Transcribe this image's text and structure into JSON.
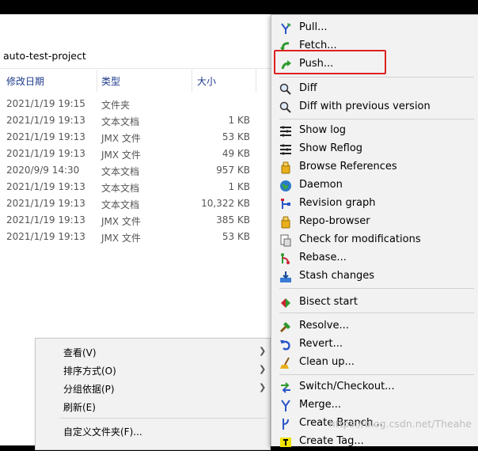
{
  "explorer": {
    "path": "auto-test-project",
    "columns": {
      "date": "修改日期",
      "type": "类型",
      "size": "大小"
    },
    "rows": [
      {
        "date": "2021/1/19 19:15",
        "type": "文件夹",
        "size": ""
      },
      {
        "date": "2021/1/19 19:13",
        "type": "文本文档",
        "size": "1 KB"
      },
      {
        "date": "2021/1/19 19:13",
        "type": "JMX 文件",
        "size": "53 KB"
      },
      {
        "date": "2021/1/19 19:13",
        "type": "JMX 文件",
        "size": "49 KB"
      },
      {
        "date": "2020/9/9 14:30",
        "type": "文本文档",
        "size": "957 KB"
      },
      {
        "date": "2021/1/19 19:13",
        "type": "文本文档",
        "size": "1 KB"
      },
      {
        "date": "2021/1/19 19:13",
        "type": "文本文档",
        "size": "10,322 KB"
      },
      {
        "date": "2021/1/19 19:13",
        "type": "JMX 文件",
        "size": "385 KB"
      },
      {
        "date": "2021/1/19 19:13",
        "type": "JMX 文件",
        "size": "53 KB"
      }
    ]
  },
  "context_menu": {
    "items": [
      {
        "label": "查看(V)",
        "has_submenu": true
      },
      {
        "label": "排序方式(O)",
        "has_submenu": true
      },
      {
        "label": "分组依据(P)",
        "has_submenu": true
      },
      {
        "label": "刷新(E)",
        "has_submenu": false
      },
      {
        "label": "自定义文件夹(F)...",
        "has_submenu": false
      }
    ]
  },
  "git_menu": {
    "items": [
      {
        "label": "Pull...",
        "icon": "pull-icon"
      },
      {
        "label": "Fetch...",
        "icon": "fetch-icon"
      },
      {
        "label": "Push...",
        "icon": "push-icon"
      },
      {
        "label": "Diff",
        "icon": "diff-icon"
      },
      {
        "label": "Diff with previous version",
        "icon": "diff-previous-icon"
      },
      {
        "label": "Show log",
        "icon": "show-log-icon"
      },
      {
        "label": "Show Reflog",
        "icon": "show-reflog-icon"
      },
      {
        "label": "Browse References",
        "icon": "browse-references-icon"
      },
      {
        "label": "Daemon",
        "icon": "daemon-icon"
      },
      {
        "label": "Revision graph",
        "icon": "revision-graph-icon"
      },
      {
        "label": "Repo-browser",
        "icon": "repo-browser-icon"
      },
      {
        "label": "Check for modifications",
        "icon": "check-modifications-icon"
      },
      {
        "label": "Rebase...",
        "icon": "rebase-icon"
      },
      {
        "label": "Stash changes",
        "icon": "stash-icon"
      },
      {
        "label": "Bisect start",
        "icon": "bisect-icon"
      },
      {
        "label": "Resolve...",
        "icon": "resolve-icon"
      },
      {
        "label": "Revert...",
        "icon": "revert-icon"
      },
      {
        "label": "Clean up...",
        "icon": "clean-up-icon"
      },
      {
        "label": "Switch/Checkout...",
        "icon": "switch-checkout-icon"
      },
      {
        "label": "Merge...",
        "icon": "merge-icon"
      },
      {
        "label": "Create Branch...",
        "icon": "create-branch-icon"
      },
      {
        "label": "Create Tag...",
        "icon": "create-tag-icon"
      }
    ]
  },
  "highlight_color": "#e02020",
  "watermark": "https://blog.csdn.net/Theahe"
}
